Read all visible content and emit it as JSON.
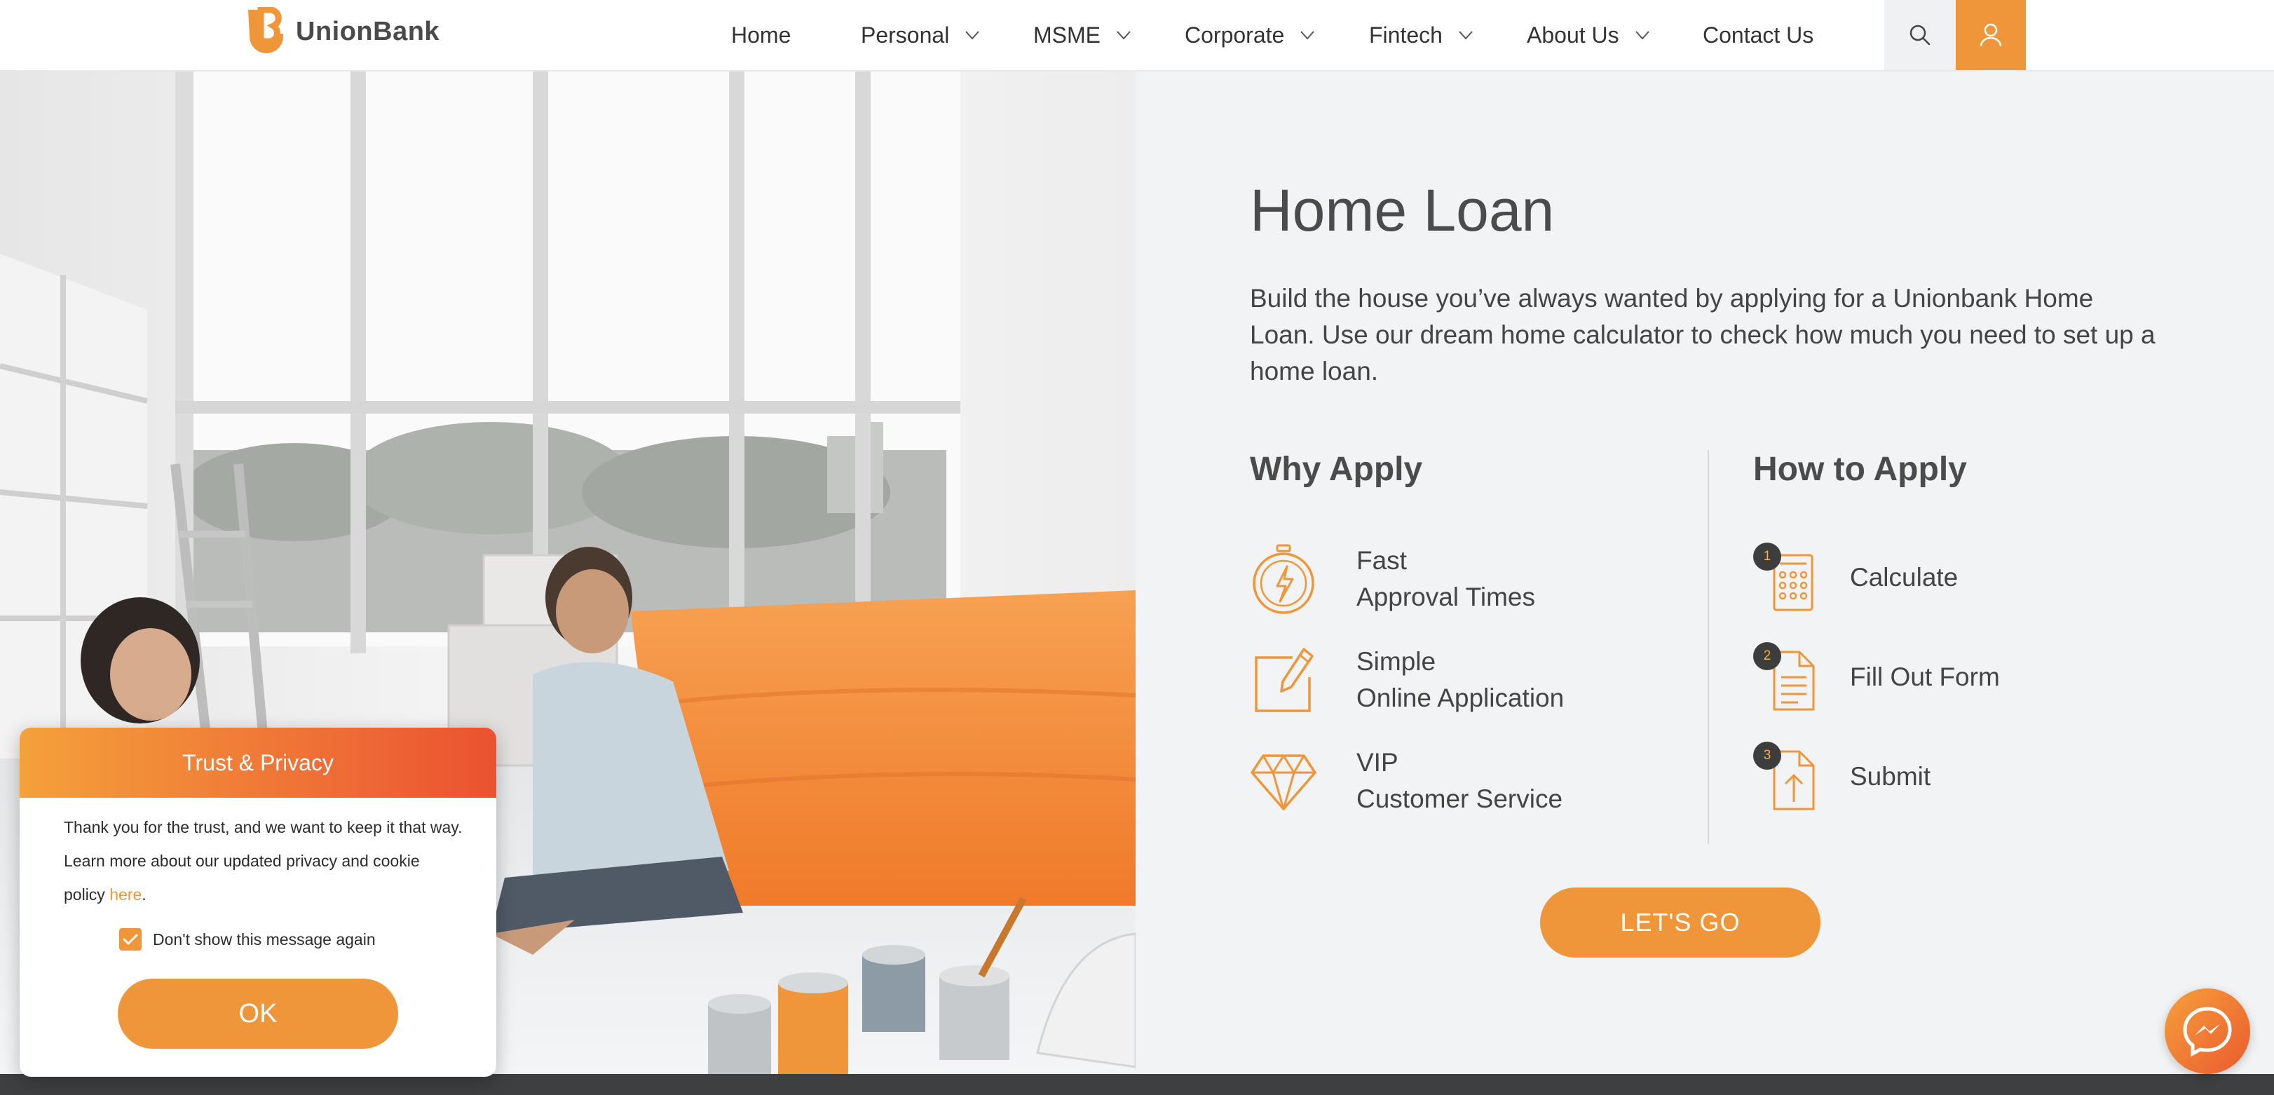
{
  "brand": {
    "name": "UnionBank",
    "accent": "#f0963a",
    "accent_dark": "#ea5230"
  },
  "nav": {
    "items": [
      {
        "label": "Home",
        "dropdown": false
      },
      {
        "label": "Personal",
        "dropdown": true
      },
      {
        "label": "MSME",
        "dropdown": true
      },
      {
        "label": "Corporate",
        "dropdown": true
      },
      {
        "label": "Fintech",
        "dropdown": true
      },
      {
        "label": "About Us",
        "dropdown": true
      },
      {
        "label": "Contact Us",
        "dropdown": false
      }
    ],
    "search_icon": "search-icon",
    "user_icon": "user-icon"
  },
  "main": {
    "title": "Home Loan",
    "description": "Build the house you’ve always wanted by applying for a Unionbank Home Loan. Use our dream home calculator to check how much you need to set up a home loan.",
    "why": {
      "heading": "Why Apply",
      "items": [
        {
          "line1": "Fast",
          "line2": "Approval Times",
          "icon": "stopwatch-icon"
        },
        {
          "line1": "Simple",
          "line2": "Online Application",
          "icon": "edit-icon"
        },
        {
          "line1": "VIP",
          "line2": "Customer Service",
          "icon": "diamond-icon"
        }
      ]
    },
    "how": {
      "heading": "How to Apply",
      "steps": [
        {
          "number": "1",
          "label": "Calculate",
          "icon": "calculator-icon"
        },
        {
          "number": "2",
          "label": "Fill Out Form",
          "icon": "form-icon"
        },
        {
          "number": "3",
          "label": "Submit",
          "icon": "upload-file-icon"
        }
      ]
    },
    "cta_label": "LET'S GO"
  },
  "privacy_modal": {
    "title": "Trust & Privacy",
    "body": "Thank you for the trust, and we want to keep it that way. Learn more about our updated privacy and cookie policy ",
    "link_label": "here",
    "body_end": ".",
    "checkbox_label": "Don't show this message again",
    "checkbox_checked": true,
    "ok_label": "OK"
  },
  "chat_fab_icon": "messenger-icon"
}
